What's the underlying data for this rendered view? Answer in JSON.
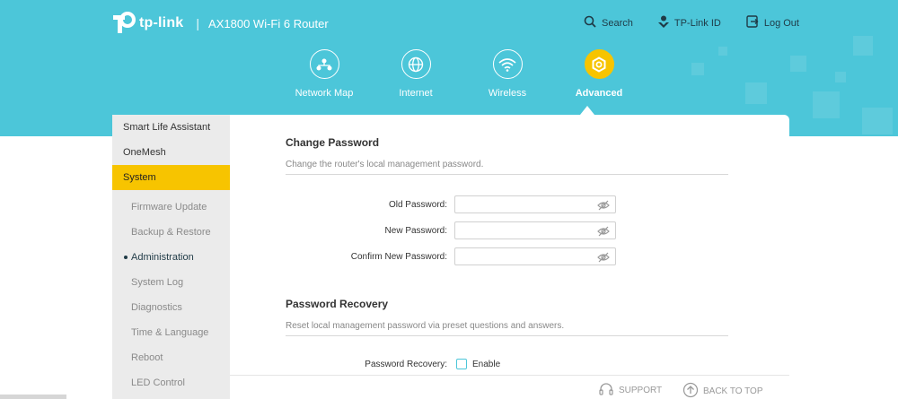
{
  "brand": {
    "logo_text": "tp-link",
    "separator": "|",
    "model": "AX1800 Wi-Fi 6 Router"
  },
  "top_links": {
    "search": "Search",
    "tplink_id": "TP-Link ID",
    "logout": "Log Out"
  },
  "nav": {
    "network_map": "Network Map",
    "internet": "Internet",
    "wireless": "Wireless",
    "advanced": "Advanced"
  },
  "sidebar": {
    "smart_life": "Smart Life Assistant",
    "onemesh": "OneMesh",
    "system": "System",
    "sub": [
      "Firmware Update",
      "Backup & Restore",
      "Administration",
      "System Log",
      "Diagnostics",
      "Time & Language",
      "Reboot",
      "LED Control"
    ]
  },
  "change_password": {
    "title": "Change Password",
    "description": "Change the router's local management password.",
    "old_label": "Old Password:",
    "new_label": "New Password:",
    "confirm_label": "Confirm New Password:",
    "old_value": "",
    "new_value": "",
    "confirm_value": ""
  },
  "password_recovery": {
    "title": "Password Recovery",
    "description": "Reset local management password via preset questions and answers.",
    "label": "Password Recovery:",
    "enable_label": "Enable",
    "enabled": false
  },
  "footer": {
    "support": "SUPPORT",
    "back_to_top": "BACK TO TOP"
  },
  "colors": {
    "header": "#4cc6d9",
    "accent": "#f7c400",
    "sidebar": "#ebebeb"
  },
  "icons": [
    "search-icon",
    "tplink-id-icon",
    "logout-icon",
    "network-map-icon",
    "globe-icon",
    "wifi-icon",
    "gear-icon",
    "eye-slash-icon",
    "headset-icon",
    "arrow-up-icon"
  ]
}
